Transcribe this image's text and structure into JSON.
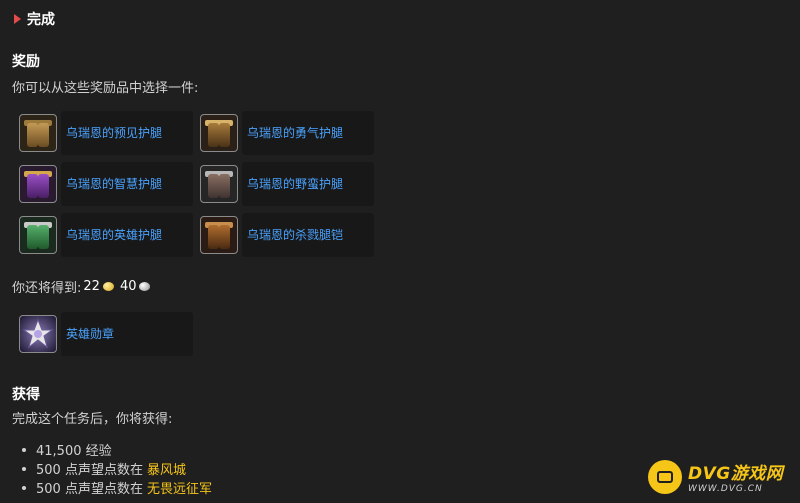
{
  "complete": {
    "label": "完成"
  },
  "rewards": {
    "heading": "奖励",
    "choose_text": "你可以从这些奖励品中选择一件:",
    "items": [
      {
        "name": "乌瑞恩的预见护腿",
        "icon": "legguards-gold-icon"
      },
      {
        "name": "乌瑞恩的勇气护腿",
        "icon": "legguards-bronze-icon"
      },
      {
        "name": "乌瑞恩的智慧护腿",
        "icon": "legguards-purple-icon"
      },
      {
        "name": "乌瑞恩的野蛮护腿",
        "icon": "legguards-gray-icon"
      },
      {
        "name": "乌瑞恩的英雄护腿",
        "icon": "legguards-green-icon"
      },
      {
        "name": "乌瑞恩的杀戮腿铠",
        "icon": "legplates-bronze-icon"
      }
    ]
  },
  "also_receive": {
    "label": "你还将得到:",
    "gold": "22",
    "silver": "40",
    "item": {
      "name": "英雄勋章",
      "icon": "hero-medal-icon"
    }
  },
  "gains": {
    "heading": "获得",
    "desc": "完成这个任务后，你将获得:",
    "list": [
      {
        "text": "41,500 经验",
        "highlight": ""
      },
      {
        "text": "500 点声望点数在",
        "highlight": "暴风城"
      },
      {
        "text": "500 点声望点数在",
        "highlight": "无畏远征军"
      }
    ]
  },
  "watermark": {
    "title": "DVG游戏网",
    "url": "WWW.DVG.CN"
  },
  "colors": {
    "link": "#4aa3ff",
    "highlight": "#f5c518",
    "background": "#1f1f1f"
  }
}
